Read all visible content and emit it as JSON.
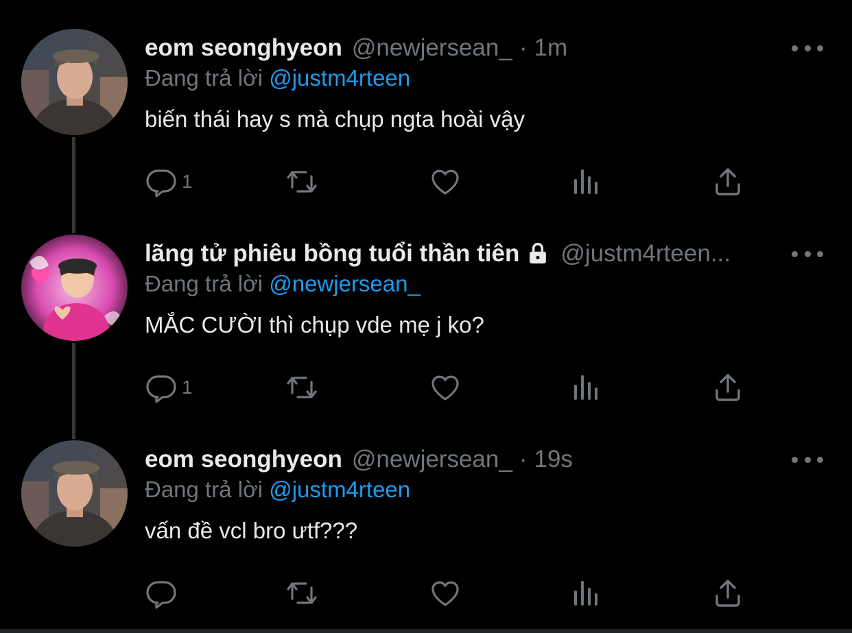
{
  "reply_prefix": "Đang trả lời",
  "tweets": [
    {
      "name": "eom seonghyeon",
      "handle": "@newjersean_",
      "separator": "·",
      "time": "1m",
      "reply_to": "@justm4rteen",
      "text": "biến thái hay s mà chụp ngta hoài vậy",
      "reply_count": "1",
      "locked": false
    },
    {
      "name": "lãng tử phiêu bồng tuổi thần tiên",
      "handle": "@justm4rteen...",
      "separator": "",
      "time": "",
      "reply_to": "@newjersean_",
      "text": "MẮC CƯỜI thì chụp vde mẹ j ko?",
      "reply_count": "1",
      "locked": true
    },
    {
      "name": "eom seonghyeon",
      "handle": "@newjersean_",
      "separator": "·",
      "time": "19s",
      "reply_to": "@justm4rteen",
      "text": "vấn đề vcl bro ưtf???",
      "reply_count": "",
      "locked": false
    }
  ],
  "icons": {
    "reply": "reply-icon",
    "retweet": "retweet-icon",
    "like": "heart-icon",
    "views": "analytics-icon",
    "share": "share-icon",
    "more": "more-options-icon",
    "lock": "lock-icon"
  },
  "colors": {
    "background": "#000000",
    "text": "#e7e9ea",
    "muted": "#71767b",
    "mention": "#1d9bf0"
  }
}
